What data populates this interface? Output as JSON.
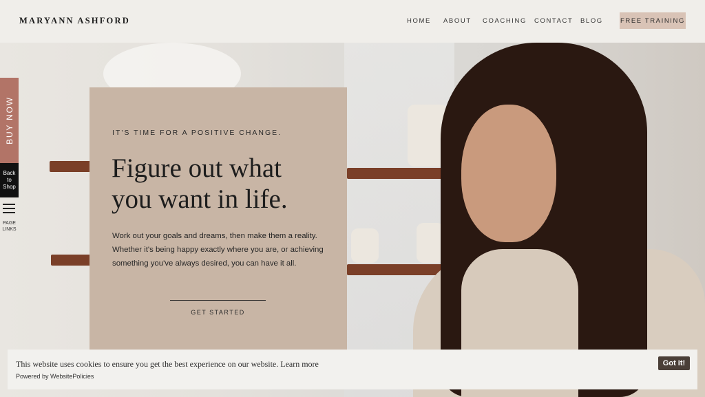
{
  "header": {
    "logo": "MARYANN ASHFORD",
    "nav": [
      {
        "label": "HOME"
      },
      {
        "label": "ABOUT"
      },
      {
        "label": "COACHING"
      },
      {
        "label": "CONTACT"
      },
      {
        "label": "BLOG"
      }
    ],
    "cta_label": "FREE TRAINING"
  },
  "hero": {
    "eyebrow": "IT'S TIME FOR A POSITIVE CHANGE.",
    "headline_line1": "Figure out what",
    "headline_line2": "you want in life.",
    "body": "Work out your goals and dreams, then make them a reality. Whether it's being happy exactly where you are, or achieving something you've always desired, you can have it all.",
    "button_label": "GET STARTED"
  },
  "side": {
    "buy_now": "BUY NOW",
    "back_line1": "Back",
    "back_line2": "to",
    "back_line3": "Shop",
    "page_links_line1": "PAGE",
    "page_links_line2": "LINKS"
  },
  "cookie": {
    "message": "This website uses cookies to ensure you get the best experience on our website.",
    "learn_more": "Learn more",
    "powered_by": "Powered by WebsitePolicies",
    "accept_label": "Got it!"
  },
  "colors": {
    "card": "#c8b5a5",
    "cta": "#d9c3b6",
    "buy_now": "#b27467",
    "accept": "#4a3f38"
  }
}
